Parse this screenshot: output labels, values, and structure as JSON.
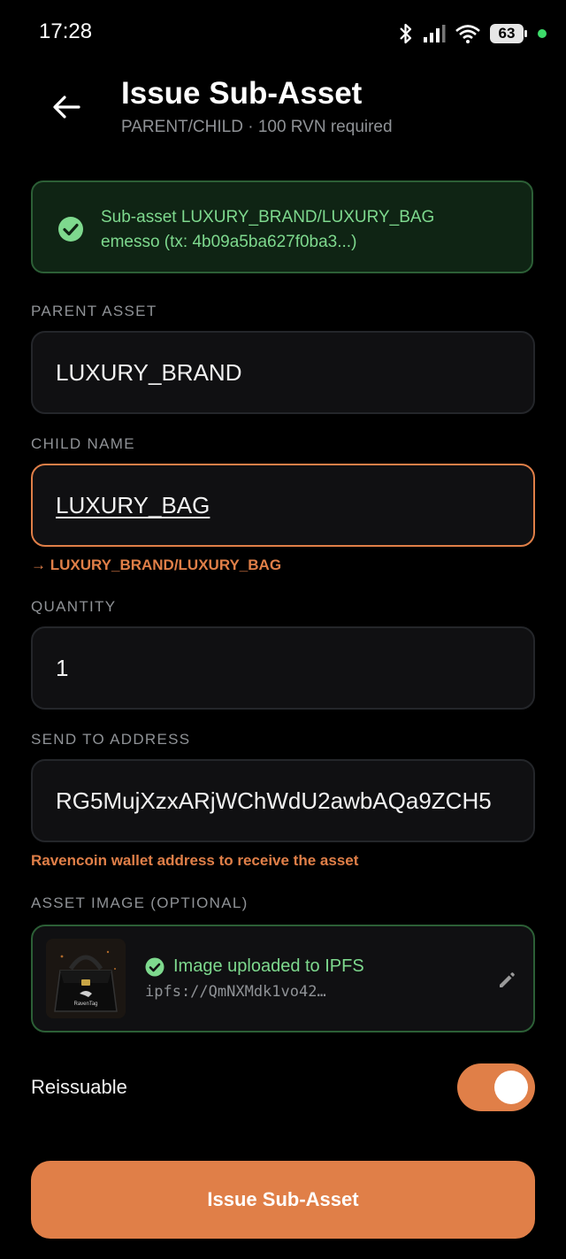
{
  "status_bar": {
    "time": "17:28",
    "battery": "63",
    "icons": [
      "bluetooth-icon",
      "signal-icon",
      "wifi-icon",
      "battery-icon",
      "active-dot"
    ]
  },
  "header": {
    "title": "Issue Sub-Asset",
    "subtitle": "PARENT/CHILD · 100 RVN required"
  },
  "banner": {
    "line1": "Sub-asset LUXURY_BRAND/LUXURY_BAG",
    "line2": "emesso (tx: 4b09a5ba627f0ba3...)"
  },
  "form": {
    "parent_asset": {
      "label": "PARENT ASSET",
      "value": "LUXURY_BRAND"
    },
    "child_name": {
      "label": "CHILD NAME",
      "value": "LUXURY_BAG",
      "hint": "→ LUXURY_BRAND/LUXURY_BAG"
    },
    "quantity": {
      "label": "QUANTITY",
      "value": "1"
    },
    "send_to": {
      "label": "SEND TO ADDRESS",
      "value": "RG5MujXzxARjWChWdU2awbAQa9ZCH5",
      "hint": "Ravencoin wallet address to receive the asset"
    },
    "asset_image": {
      "label": "ASSET IMAGE (OPTIONAL)",
      "status": "Image uploaded to IPFS",
      "ipfs": "ipfs://QmNXMdk1vo42…",
      "thumb_text": "RavenTag"
    },
    "reissuable": {
      "label": "Reissuable",
      "enabled": true
    }
  },
  "primary_action": {
    "label": "Issue Sub-Asset"
  },
  "colors": {
    "accent": "#e07f48",
    "success": "#7ed98e",
    "success_border": "#2c5f36",
    "background": "#000000",
    "field_bg": "#101012"
  }
}
